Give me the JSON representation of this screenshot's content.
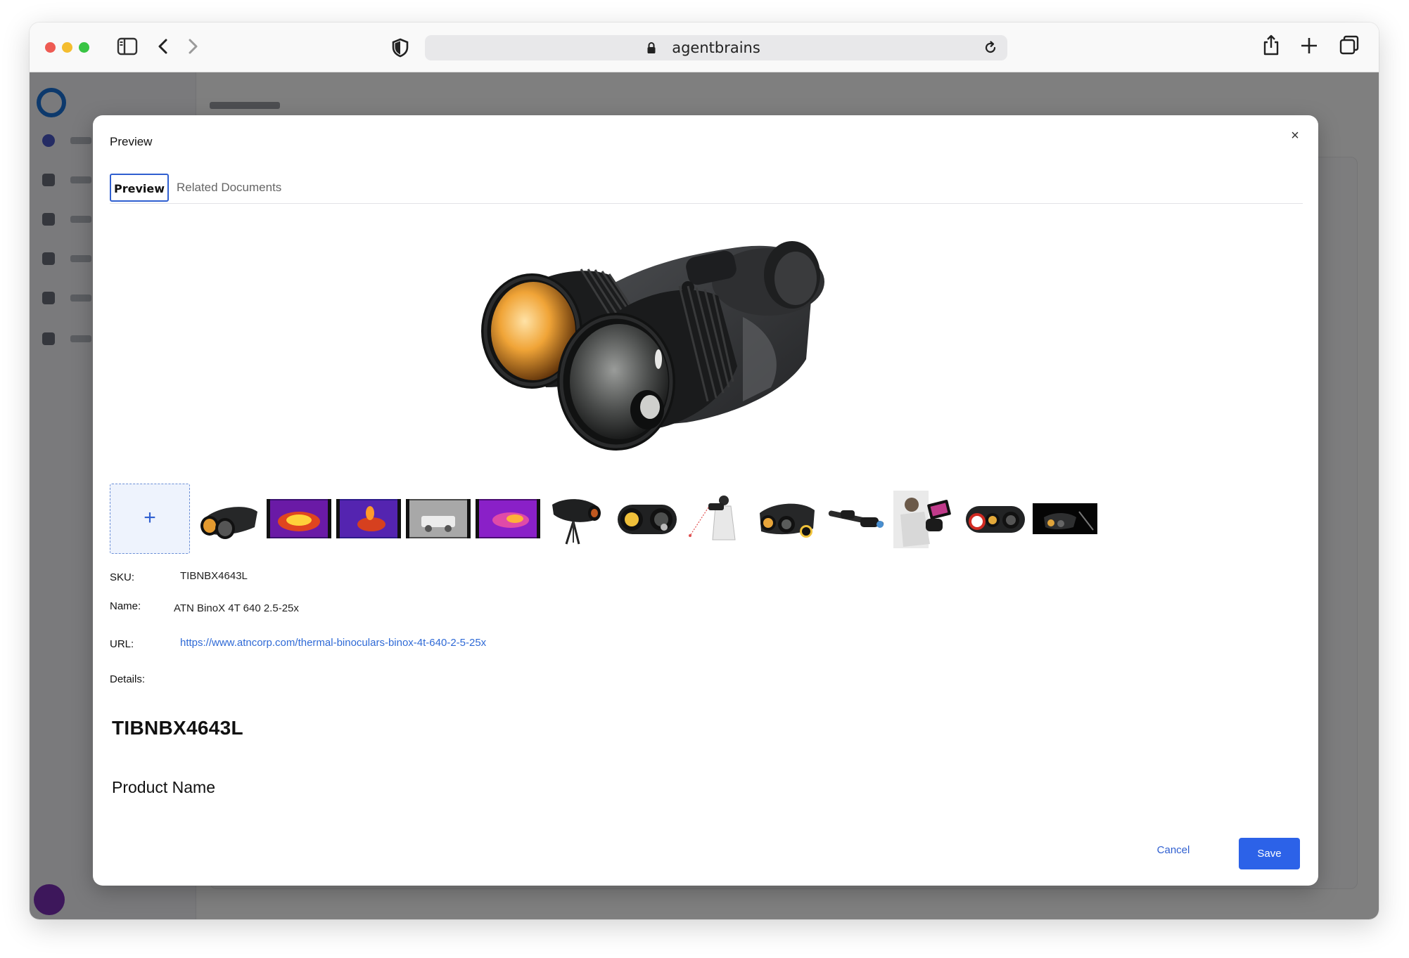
{
  "browser": {
    "url": "agentbrains"
  },
  "modal": {
    "title": "Preview",
    "close_label": "×",
    "tabs": [
      {
        "label": "Preview",
        "active": true
      },
      {
        "label": "Related Documents",
        "active": false
      }
    ],
    "add_image_label": "+",
    "thumbnails": [
      "binocular-front-angle",
      "thermal-car-purple",
      "thermal-rider-purple",
      "thermal-truck-grayscale",
      "thermal-car-magenta",
      "binocular-on-tripod",
      "binocular-front-lenses",
      "hunter-with-rangefinder",
      "binocular-lens-badge",
      "binocular-rifle-mount",
      "hunter-with-tablet",
      "binocular-red-badge",
      "binocular-dark-studio"
    ],
    "fields": {
      "sku_label": "SKU:",
      "sku_value": "TIBNBX4643L",
      "name_label": "Name:",
      "name_value": "ATN BinoX 4T 640 2.5-25x",
      "url_label": "URL:",
      "url_value": "https://www.atncorp.com/thermal-binoculars-binox-4t-640-2-5-25x",
      "details_label": "Details:"
    },
    "details": {
      "heading": "TIBNBX4643L",
      "subheading": "Product Name"
    },
    "buttons": {
      "cancel": "Cancel",
      "save": "Save"
    }
  },
  "colors": {
    "accent": "#2c62e8",
    "link": "#2f6ad6",
    "overlay": "rgba(0,0,0,0.5)"
  }
}
